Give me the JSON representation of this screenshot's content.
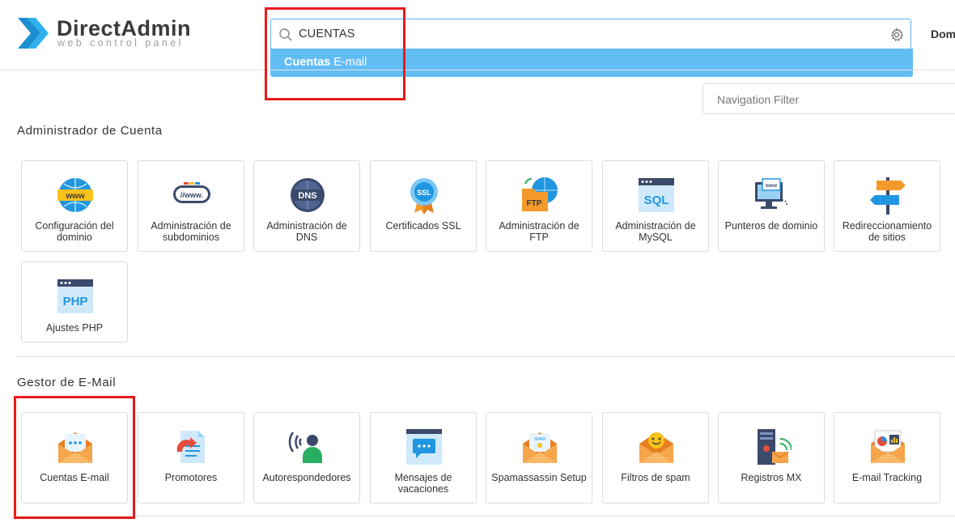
{
  "brand": {
    "name": "DirectAdmin",
    "tagline": "web control panel"
  },
  "search": {
    "value": "CUENTAS",
    "suggestion_bold": "Cuentas",
    "suggestion_rest": " E-mail"
  },
  "header": {
    "right_text": "Dom"
  },
  "nav_filter": {
    "placeholder": "Navigation Filter"
  },
  "sections": [
    {
      "title": "Administrador de Cuenta",
      "items": [
        {
          "label": "Configuración del dominio",
          "icon": "www-globe-icon"
        },
        {
          "label": "Administración de subdominios",
          "icon": "subdomain-bar-icon"
        },
        {
          "label": "Administración de DNS",
          "icon": "dns-globe-icon"
        },
        {
          "label": "Certificados SSL",
          "icon": "ssl-badge-icon"
        },
        {
          "label": "Administración de FTP",
          "icon": "ftp-folder-icon"
        },
        {
          "label": "Administración de MySQL",
          "icon": "sql-window-icon"
        },
        {
          "label": "Punteros de dominio",
          "icon": "monitor-pointer-icon"
        },
        {
          "label": "Redireccionamiento de sitios",
          "icon": "signpost-icon"
        },
        {
          "label": "Ajustes PHP",
          "icon": "php-window-icon"
        }
      ]
    },
    {
      "title": "Gestor de E-Mail",
      "items": [
        {
          "label": "Cuentas E-mail",
          "icon": "email-envelope-icon"
        },
        {
          "label": "Promotores",
          "icon": "forwarder-document-icon"
        },
        {
          "label": "Autorespondedores",
          "icon": "autoresponder-person-icon"
        },
        {
          "label": "Mensajes de vacaciones",
          "icon": "vacation-message-icon"
        },
        {
          "label": "Spamassassin Setup",
          "icon": "spam-envelope-icon"
        },
        {
          "label": "Filtros de spam",
          "icon": "smiley-envelope-icon"
        },
        {
          "label": "Registros MX",
          "icon": "server-wifi-icon"
        },
        {
          "label": "E-mail Tracking",
          "icon": "chart-envelope-icon"
        }
      ]
    }
  ],
  "colors": {
    "accent": "#62bdf5",
    "highlight": "#e61b1b",
    "logo": "#1e9bd7"
  }
}
